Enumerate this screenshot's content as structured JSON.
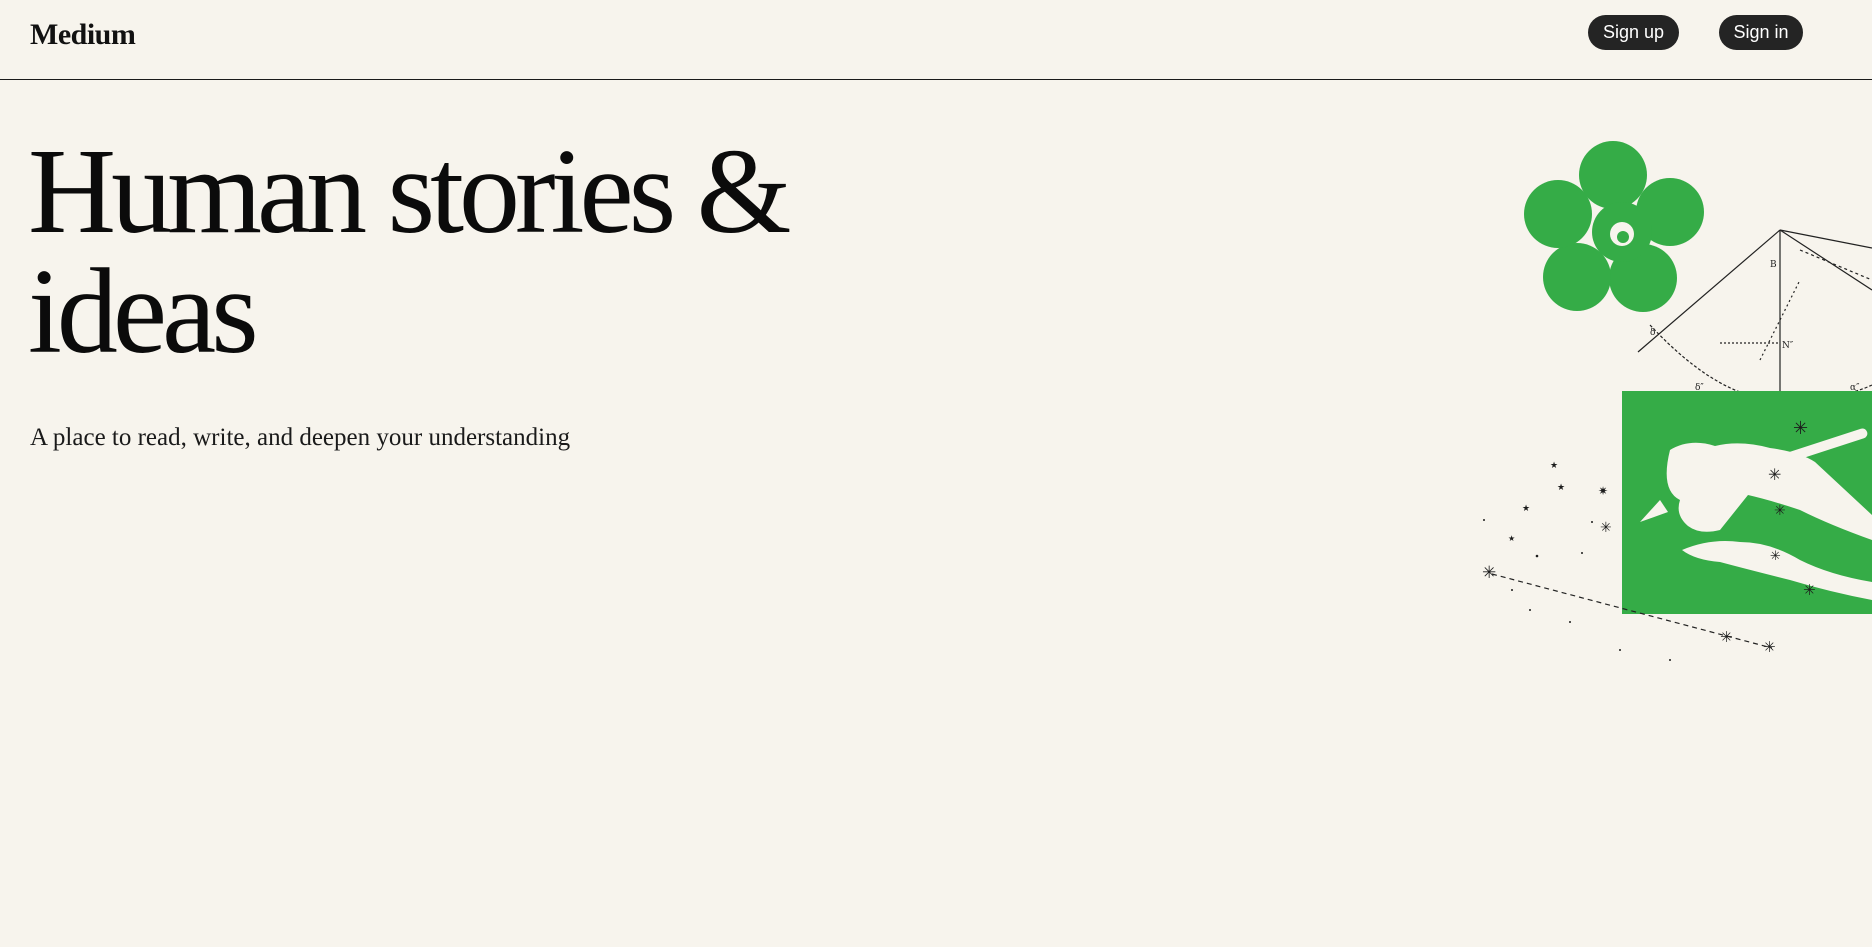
{
  "header": {
    "logo": "Medium",
    "sign_up_label": "Sign up",
    "sign_in_label": "Sign in"
  },
  "hero": {
    "title": "Human stories & ideas",
    "subtitle": "A place to read, write, and deepen your understanding"
  },
  "illustration": {
    "icon": "flower-hand-writing-illustration",
    "accent_color": "#35AC47",
    "background_color": "#F7F4ED"
  }
}
